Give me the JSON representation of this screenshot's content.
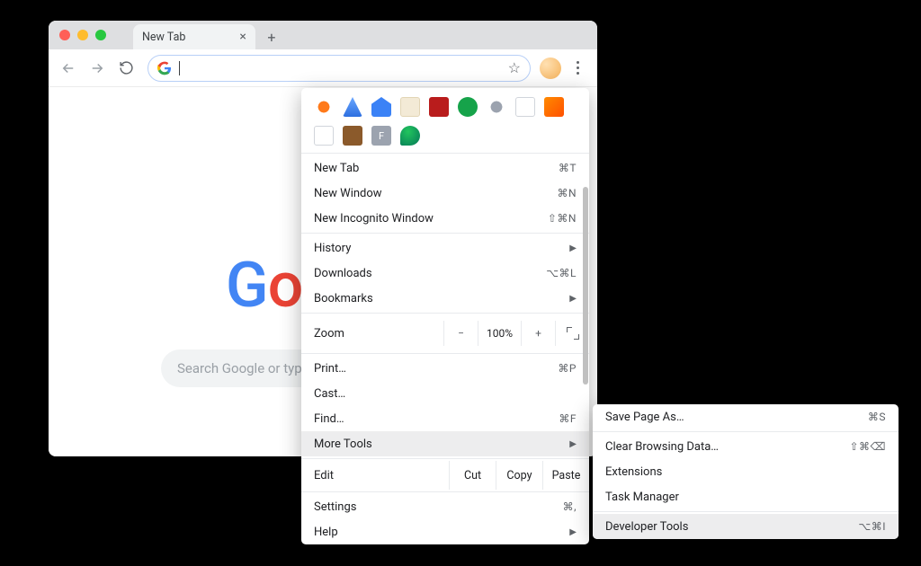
{
  "tab": {
    "title": "New Tab"
  },
  "search": {
    "placeholder": "Search Google or type a URL"
  },
  "menu": {
    "new_tab": {
      "label": "New Tab",
      "shortcut": "⌘T"
    },
    "new_window": {
      "label": "New Window",
      "shortcut": "⌘N"
    },
    "new_incognito": {
      "label": "New Incognito Window",
      "shortcut": "⇧⌘N"
    },
    "history": {
      "label": "History"
    },
    "downloads": {
      "label": "Downloads",
      "shortcut": "⌥⌘L"
    },
    "bookmarks": {
      "label": "Bookmarks"
    },
    "zoom": {
      "label": "Zoom",
      "level": "100%"
    },
    "print": {
      "label": "Print…",
      "shortcut": "⌘P"
    },
    "cast": {
      "label": "Cast…"
    },
    "find": {
      "label": "Find…",
      "shortcut": "⌘F"
    },
    "more_tools": {
      "label": "More Tools"
    },
    "edit": {
      "label": "Edit",
      "cut": "Cut",
      "copy": "Copy",
      "paste": "Paste"
    },
    "settings": {
      "label": "Settings",
      "shortcut": "⌘,"
    },
    "help": {
      "label": "Help"
    }
  },
  "submenu": {
    "save_page": {
      "label": "Save Page As…",
      "shortcut": "⌘S"
    },
    "clear_data": {
      "label": "Clear Browsing Data…",
      "shortcut": "⇧⌘⌫"
    },
    "extensions": {
      "label": "Extensions"
    },
    "task_manager": {
      "label": "Task Manager"
    },
    "devtools": {
      "label": "Developer Tools",
      "shortcut": "⌥⌘I"
    }
  }
}
